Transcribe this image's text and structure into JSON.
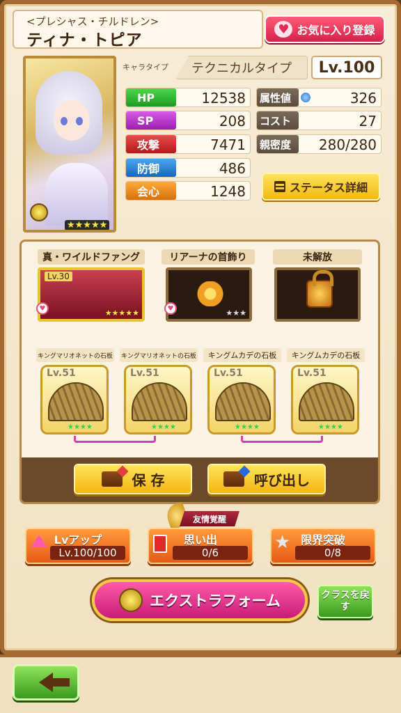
{
  "header": {
    "subtitle": "<プレシャス・チルドレン>",
    "name": "ティナ・トピア",
    "favorite_label": "お気に入り登録",
    "heart_glyph": "♥"
  },
  "portrait": {
    "stars": "★★★★★"
  },
  "profile": {
    "type_label": "キャラタイプ",
    "type_value": "テクニカルタイプ",
    "level": "Lv.100"
  },
  "stats_left": [
    {
      "label": "HP",
      "value": "12538",
      "color": "#2eb82e"
    },
    {
      "label": "SP",
      "value": "208",
      "color": "#c23bd0"
    },
    {
      "label": "攻撃",
      "value": "7471",
      "color": "#d62a2a"
    },
    {
      "label": "防御",
      "value": "486",
      "color": "#2a86d6"
    },
    {
      "label": "会心",
      "value": "1248",
      "color": "#ee8a1a"
    }
  ],
  "stats_right": [
    {
      "label": "属性値",
      "value": "326"
    },
    {
      "label": "コスト",
      "value": "27"
    },
    {
      "label": "親密度",
      "value": "280/280"
    }
  ],
  "status_detail_label": "ステータス詳細",
  "equipment": {
    "slots": [
      {
        "name": "真・ワイルドファング",
        "level": "Lv.30",
        "stars": "★★★★★"
      },
      {
        "name": "リアーナの首飾り",
        "stars": "★★★"
      },
      {
        "name": "未解放"
      }
    ],
    "stones": [
      {
        "name": "キングマリオネットの石板",
        "level": "Lv.51",
        "stars": "★★★★"
      },
      {
        "name": "キングマリオネットの石板",
        "level": "Lv.51",
        "stars": "★★★★"
      },
      {
        "name": "キングムカデの石板",
        "level": "Lv.51",
        "stars": "★★★★"
      },
      {
        "name": "キングムカデの石板",
        "level": "Lv.51",
        "stars": "★★★★"
      }
    ],
    "save_label": "保 存",
    "load_label": "呼び出し"
  },
  "actions": {
    "badge": "友情覚醒",
    "levelup_title": "Lvアップ",
    "levelup_sub": "Lv.100/100",
    "memory_title": "思い出",
    "memory_sub": "0/6",
    "limit_title": "限界突破",
    "limit_sub": "0/8"
  },
  "extra_form_label": "エクストラフォーム",
  "class_back_label": "クラスを戻す"
}
